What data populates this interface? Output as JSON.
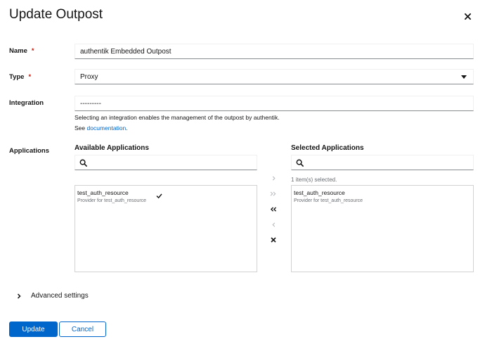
{
  "modal": {
    "title": "Update Outpost",
    "close_icon": "close-icon"
  },
  "form": {
    "name": {
      "label": "Name",
      "required": "*",
      "value": "authentik Embedded Outpost"
    },
    "type": {
      "label": "Type",
      "required": "*",
      "value": "Proxy"
    },
    "integration": {
      "label": "Integration",
      "value": "---------",
      "help_line1": "Selecting an integration enables the management of the outpost by authentik.",
      "help_see": "See ",
      "help_link": "documentation",
      "help_end": "."
    },
    "applications": {
      "label": "Applications",
      "available": {
        "title": "Available Applications",
        "search_placeholder": "",
        "items": [
          {
            "title": "test_auth_resource",
            "desc": "Provider for test_auth_resource"
          }
        ]
      },
      "selected": {
        "title": "Selected Applications",
        "search_placeholder": "",
        "status": "1 item(s) selected.",
        "items": [
          {
            "title": "test_auth_resource",
            "desc": "Provider for test_auth_resource"
          }
        ]
      },
      "controls": {
        "add_selected": ">",
        "add_all": ">>",
        "remove_all": "«",
        "remove_selected": "<",
        "clear": "×"
      }
    },
    "advanced": {
      "label": "Advanced settings"
    }
  },
  "footer": {
    "update_label": "Update",
    "cancel_label": "Cancel"
  },
  "colors": {
    "primary": "#0066cc",
    "required": "#c9190b",
    "muted": "#6a6e73"
  }
}
